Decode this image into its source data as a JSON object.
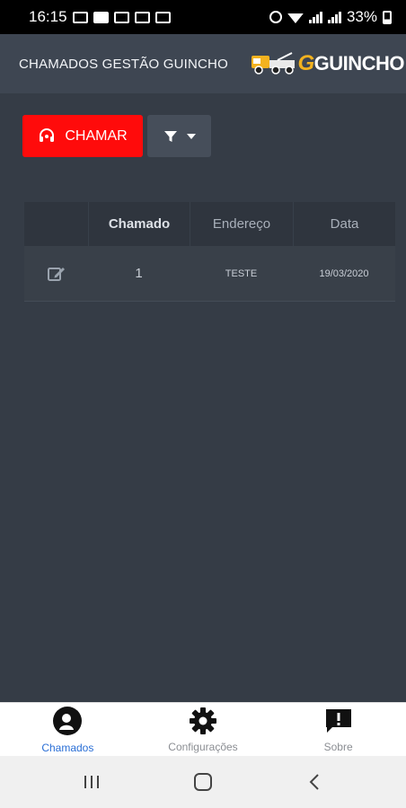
{
  "status_bar": {
    "time": "16:15",
    "battery": "33%"
  },
  "header": {
    "title": "CHAMADOS GESTÃO GUINCHO",
    "logo_letter": "G",
    "logo_text": "GUINCHO"
  },
  "toolbar": {
    "call_label": "CHAMAR",
    "call_color": "#ff0b0b"
  },
  "table": {
    "columns": [
      "",
      "Chamado",
      "Endereço",
      "Data"
    ],
    "rows": [
      {
        "chamado": "1",
        "endereco": "TESTE",
        "data": "19/03/2020"
      }
    ]
  },
  "bottom_nav": {
    "items": [
      {
        "label": "Chamados",
        "icon": "headset-support-icon",
        "active": true
      },
      {
        "label": "Configurações",
        "icon": "gear-icon",
        "active": false
      },
      {
        "label": "Sobre",
        "icon": "info-message-icon",
        "active": false
      }
    ],
    "active_color": "#2a6fd6"
  },
  "system_nav": {
    "buttons": [
      "recent-apps-icon",
      "home-icon",
      "back-icon"
    ]
  }
}
